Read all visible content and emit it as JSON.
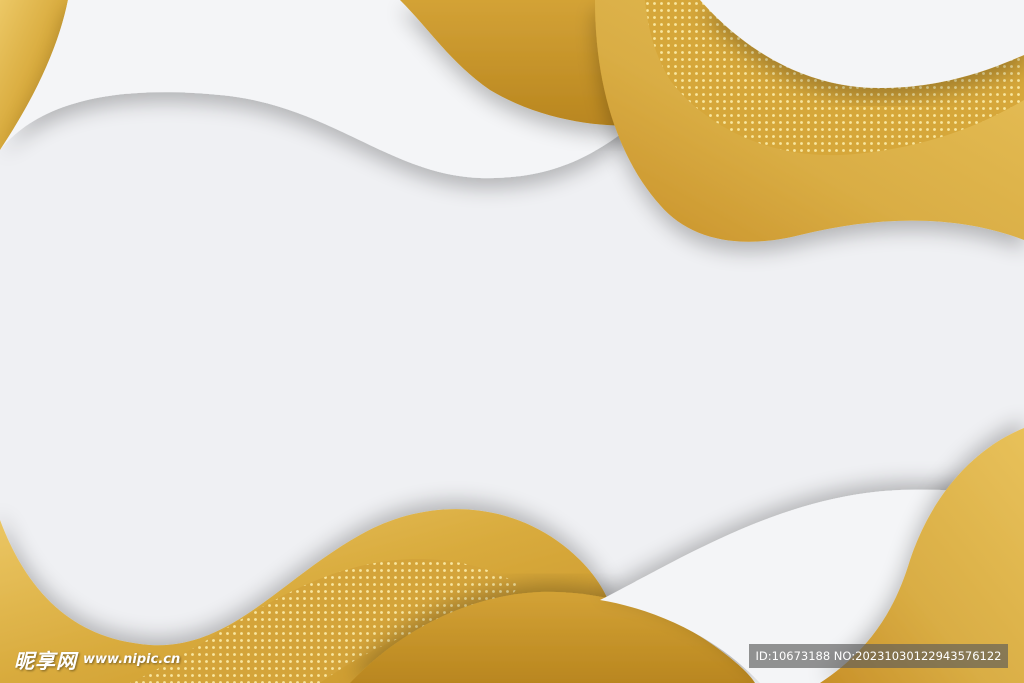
{
  "colors": {
    "background": "#eff0f3",
    "gold_light": "#ecc866",
    "gold_mid": "#d8aa3c",
    "gold_dark": "#c8942a",
    "dot": "#fff2b0"
  },
  "watermark": {
    "logo_text": "昵享网",
    "url": "www.nipic.cn",
    "id_text": "ID:10673188 NO:20231030122943576122"
  }
}
